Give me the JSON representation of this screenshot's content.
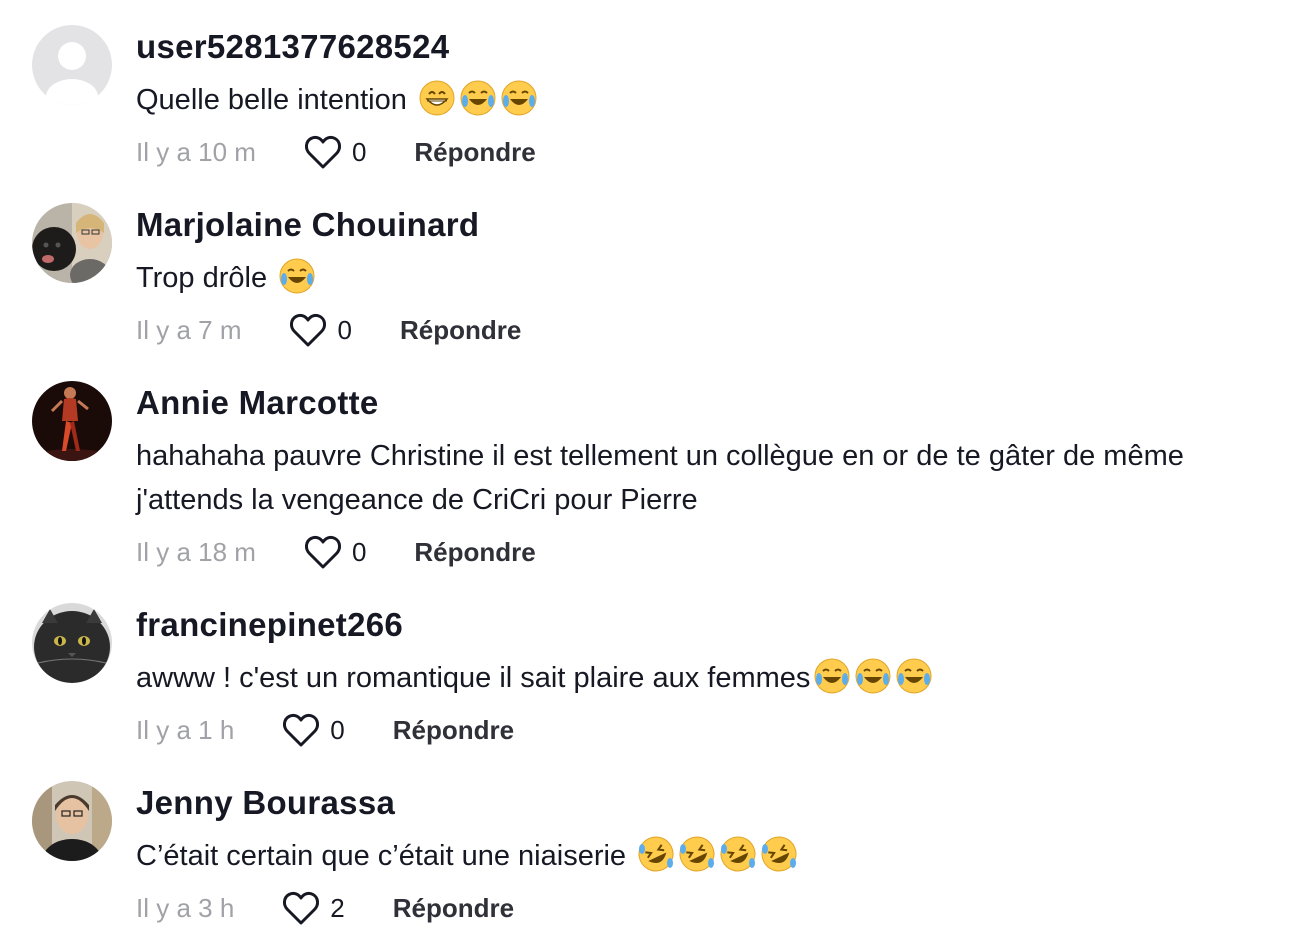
{
  "comments": [
    {
      "username": "user5281377628524",
      "text": "Quelle belle intention ",
      "emojis": [
        "grin-emoji",
        "joy-emoji",
        "joy-emoji"
      ],
      "time": "Il y a 10 m",
      "likes": "0",
      "reply_label": "Répondre",
      "avatar": "default-avatar"
    },
    {
      "username": "Marjolaine Chouinard",
      "text": "Trop drôle ",
      "emojis": [
        "joy-emoji"
      ],
      "time": "Il y a 7 m",
      "likes": "0",
      "reply_label": "Répondre",
      "avatar": "photo-woman-with-dog"
    },
    {
      "username": "Annie Marcotte",
      "text": "hahahaha pauvre Christine il est tellement un collègue en or de te gâter de même j'attends la vengeance de CriCri pour Pierre",
      "emojis": [],
      "time": "Il y a 18 m",
      "likes": "0",
      "reply_label": "Répondre",
      "avatar": "photo-stage-performer"
    },
    {
      "username": "francinepinet266",
      "text": "awww ! c'est un romantique il sait plaire aux femmes",
      "emojis": [
        "joy-emoji",
        "joy-emoji",
        "joy-emoji"
      ],
      "time": "Il y a 1 h",
      "likes": "0",
      "reply_label": "Répondre",
      "avatar": "photo-black-cat"
    },
    {
      "username": "Jenny Bourassa",
      "text": "C’était certain que c’était une niaiserie ",
      "emojis": [
        "rofl-emoji",
        "rofl-emoji",
        "rofl-emoji",
        "rofl-emoji"
      ],
      "time": "Il y a 3 h",
      "likes": "2",
      "reply_label": "Répondre",
      "avatar": "photo-woman-glasses"
    }
  ],
  "colors": {
    "text": "#161823",
    "muted": "#a1a2a7",
    "reply": "#2f3038",
    "background": "#ffffff"
  }
}
